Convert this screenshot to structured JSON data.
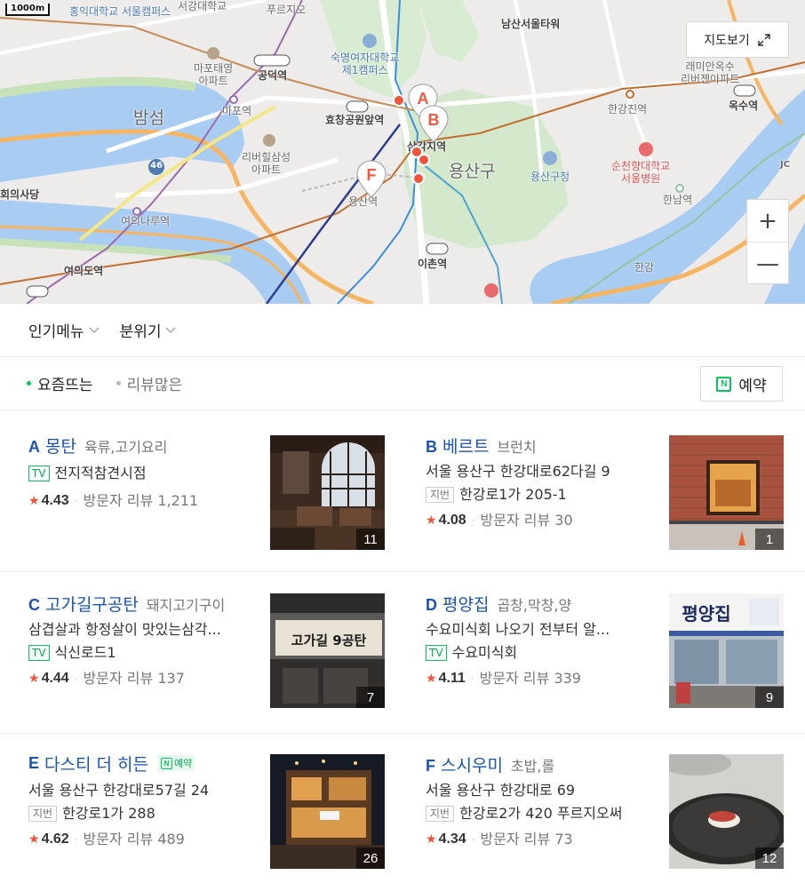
{
  "map": {
    "scale_label": "1000m",
    "view_button_label": "지도보기",
    "zoom_in": "+",
    "zoom_out": "—",
    "labels": {
      "hongik": "홍익대학교\n서울캠퍼스",
      "seogang": "서강대학교",
      "prugio": "푸르지오",
      "namsan": "남산서울타워",
      "sookmyung": "숙명여자대학교\n제1캠퍼스",
      "mapo_apt": "마포태영\n아파트",
      "gongdeok": "공덕역",
      "hyochang": "효창공원앞역",
      "bamseom": "밤섬",
      "mapo_st": "마포역",
      "riverpark": "리버힐삼성\n아파트",
      "hangangjin": "한강진역",
      "raemian": "래미안옥수\n리버젠아파트",
      "oksu": "옥수역",
      "yongsan_gu": "용산구",
      "yongsan_office": "용산구청",
      "soonchunhyang": "순천향대학교\n서울병원",
      "hannam": "한남역",
      "assembly": "회의사당",
      "yeouinaru": "여의나루역",
      "yeouido": "여의도역",
      "ichon": "이촌역",
      "hangang": "한강",
      "samgakji": "삼각지역",
      "yongsan_st": "용산역",
      "route46": "46",
      "jc": "JC"
    },
    "pins": [
      "A",
      "B",
      "F"
    ]
  },
  "filters": {
    "menu_label": "인기메뉴",
    "mood_label": "분위기"
  },
  "sort": {
    "trending_label": "요즘뜨는",
    "reviews_label": "리뷰많은",
    "reserve_label": "예약",
    "reserve_icon_text": "N"
  },
  "places": [
    {
      "letter": "A",
      "name": "몽탄",
      "category": "육류,고기요리",
      "lines": [
        {
          "tag": "TV",
          "text": "전지적참견시점"
        }
      ],
      "rating": "4.43",
      "review_label": "방문자 리뷰",
      "review_count": "1,211",
      "photo_count": "11"
    },
    {
      "letter": "B",
      "name": "베르트",
      "category": "브런치",
      "lines": [
        {
          "tag": "",
          "text": "서울 용산구 한강대로62다길 9"
        },
        {
          "tag": "지번",
          "text": "한강로1가 205-1"
        }
      ],
      "rating": "4.08",
      "review_label": "방문자 리뷰",
      "review_count": "30",
      "photo_count": "1"
    },
    {
      "letter": "C",
      "name": "고가길구공탄",
      "category": "돼지고기구이",
      "lines": [
        {
          "tag": "",
          "text": "삼겹살과 항정살이 맛있는삼각..."
        },
        {
          "tag": "TV",
          "text": "식신로드1"
        }
      ],
      "rating": "4.44",
      "review_label": "방문자 리뷰",
      "review_count": "137",
      "photo_count": "7",
      "sign_text": "고가길  9공탄"
    },
    {
      "letter": "D",
      "name": "평양집",
      "category": "곱창,막창,양",
      "lines": [
        {
          "tag": "",
          "text": "수요미식회 나오기 전부터 알..."
        },
        {
          "tag": "TV",
          "text": "수요미식회"
        }
      ],
      "rating": "4.11",
      "review_label": "방문자 리뷰",
      "review_count": "339",
      "photo_count": "9",
      "sign_text": "평양집"
    },
    {
      "letter": "E",
      "name": "다스티 더 히든",
      "category": "",
      "badge": "예약",
      "lines": [
        {
          "tag": "",
          "text": "서울 용산구 한강대로57길 24"
        },
        {
          "tag": "지번",
          "text": "한강로1가 288"
        }
      ],
      "rating": "4.62",
      "review_label": "방문자 리뷰",
      "review_count": "489",
      "photo_count": "26"
    },
    {
      "letter": "F",
      "name": "스시우미",
      "category": "초밥,롤",
      "lines": [
        {
          "tag": "",
          "text": "서울 용산구 한강대로 69"
        },
        {
          "tag": "지번",
          "text": "한강로2가 420 푸르지오써"
        }
      ],
      "rating": "4.34",
      "review_label": "방문자 리뷰",
      "review_count": "73",
      "photo_count": "12"
    }
  ]
}
